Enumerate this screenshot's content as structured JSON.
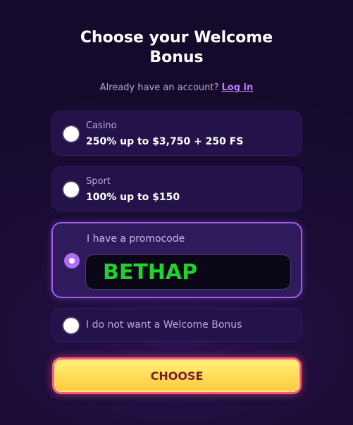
{
  "header": {
    "title_line1": "Choose your Welcome",
    "title_line2": "Bonus",
    "login_prompt": "Already have an account?",
    "login_link": "Log in"
  },
  "options": {
    "casino": {
      "label": "Casino",
      "offer": "250% up to $3,750 + 250 FS",
      "selected": false
    },
    "sport": {
      "label": "Sport",
      "offer": "100% up to $150",
      "selected": false
    },
    "promo": {
      "label": "I have a promocode",
      "code": "BETHAP",
      "selected": true
    },
    "none": {
      "label": "I do not want a Welcome Bonus",
      "selected": false
    }
  },
  "actions": {
    "choose_label": "CHOOSE"
  },
  "colors": {
    "accent": "#a45ef0",
    "link": "#c27bff",
    "promo_text": "#21d12d",
    "button_gradient_top": "#fff27a",
    "button_border": "#ff5a7a"
  }
}
